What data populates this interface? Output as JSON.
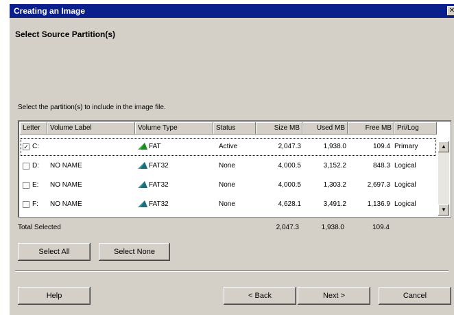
{
  "window": {
    "title": "Creating an Image",
    "close_glyph": "✕"
  },
  "heading": "Select Source Partition(s)",
  "instruction": "Select the partition(s) to include in the image file.",
  "columns": [
    "Letter",
    "Volume Label",
    "Volume Type",
    "Status",
    "Size MB",
    "Used MB",
    "Free MB",
    "Pri/Log"
  ],
  "rows": [
    {
      "checked": true,
      "letter": "C:",
      "label": "",
      "type": "FAT",
      "icon": "fat-partition-icon",
      "icon_color": "#2eb82e",
      "status": "Active",
      "size": "2,047.3",
      "used": "1,938.0",
      "free": "109.4",
      "kind": "Primary"
    },
    {
      "checked": false,
      "letter": "D:",
      "label": "NO NAME",
      "type": "FAT32",
      "icon": "fat32-partition-icon",
      "icon_color": "#2a9aa8",
      "status": "None",
      "size": "4,000.5",
      "used": "3,152.2",
      "free": "848.3",
      "kind": "Logical"
    },
    {
      "checked": false,
      "letter": "E:",
      "label": "NO NAME",
      "type": "FAT32",
      "icon": "fat32-partition-icon",
      "icon_color": "#2a9aa8",
      "status": "None",
      "size": "4,000.5",
      "used": "1,303.2",
      "free": "2,697.3",
      "kind": "Logical"
    },
    {
      "checked": false,
      "letter": "F:",
      "label": "NO NAME",
      "type": "FAT32",
      "icon": "fat32-partition-icon",
      "icon_color": "#2a9aa8",
      "status": "None",
      "size": "4,628.1",
      "used": "3,491.2",
      "free": "1,136.9",
      "kind": "Logical"
    }
  ],
  "totals": {
    "label": "Total Selected",
    "size": "2,047.3",
    "used": "1,938.0",
    "free": "109.4"
  },
  "buttons": {
    "select_all": "Select All",
    "select_none": "Select None",
    "help": "Help",
    "back": "< Back",
    "next": "Next >",
    "cancel": "Cancel"
  },
  "colors": {
    "titlebar": "#0a1e8c",
    "face": "#d4d0c8"
  }
}
